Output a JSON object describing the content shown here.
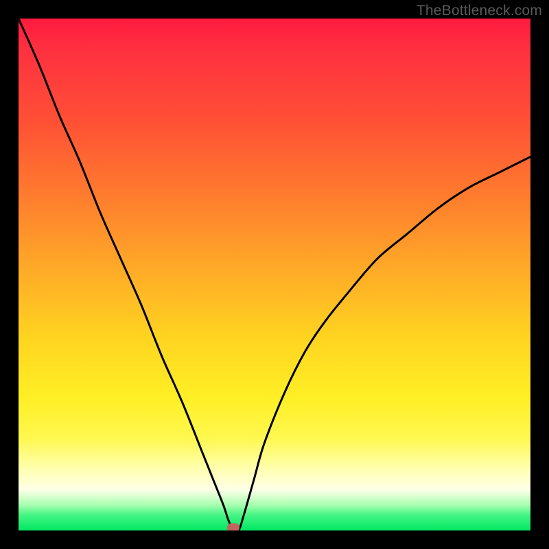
{
  "watermark": {
    "text": "TheBottleneck.com"
  },
  "colors": {
    "marker": "#c26560",
    "curve": "#000000"
  },
  "chart_data": {
    "type": "line",
    "title": "",
    "xlabel": "",
    "ylabel": "",
    "xlim": [
      0,
      100
    ],
    "ylim": [
      0,
      100
    ],
    "grid": false,
    "series": [
      {
        "name": "bottleneck-curve",
        "x": [
          0,
          4,
          8,
          12,
          16,
          20,
          24,
          28,
          32,
          36,
          38,
          40,
          41,
          42,
          43,
          44,
          46,
          48,
          52,
          56,
          60,
          64,
          70,
          76,
          82,
          88,
          94,
          100
        ],
        "y": [
          100,
          91,
          81,
          72,
          62,
          53,
          44,
          34,
          25,
          15,
          10,
          5,
          2,
          0,
          0,
          3,
          10,
          17,
          27,
          35,
          41,
          46,
          53,
          58,
          63,
          67,
          70,
          73
        ]
      }
    ],
    "annotations": [
      {
        "name": "optimal-marker",
        "x": 42,
        "y": 0
      }
    ]
  }
}
